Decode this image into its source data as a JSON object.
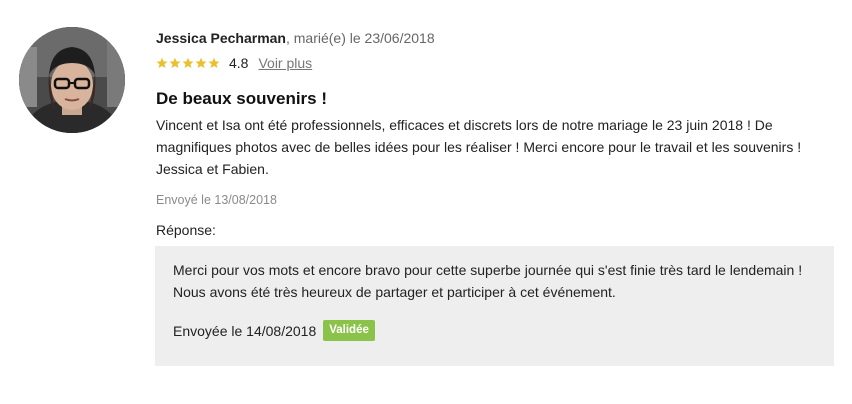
{
  "review": {
    "author": {
      "name": "Jessica Pecharman",
      "married_text": ", marié(e) le 23/06/2018"
    },
    "rating": {
      "value": "4.8",
      "stars": 5,
      "star_color": "#e9c12f",
      "see_more_label": "Voir plus"
    },
    "title": "De beaux souvenirs !",
    "body": "Vincent et Isa ont été professionnels, efficaces et discrets lors de notre mariage le 23 juin 2018 ! De magnifiques photos avec de belles idées pour les réaliser ! Merci encore pour le travail et les souvenirs ! Jessica et Fabien.",
    "sent_date": "Envoyé le 13/08/2018"
  },
  "response": {
    "label": "Réponse:",
    "text": "Merci pour vos mots et encore bravo pour cette superbe journée qui s'est finie très tard le lendemain ! Nous avons été très heureux de partager et participer à cet événement.",
    "sent_date": "Envoyée le 14/08/2018",
    "badge": "Validée",
    "badge_color": "#8bc34a",
    "box_color": "#eeeeee"
  }
}
